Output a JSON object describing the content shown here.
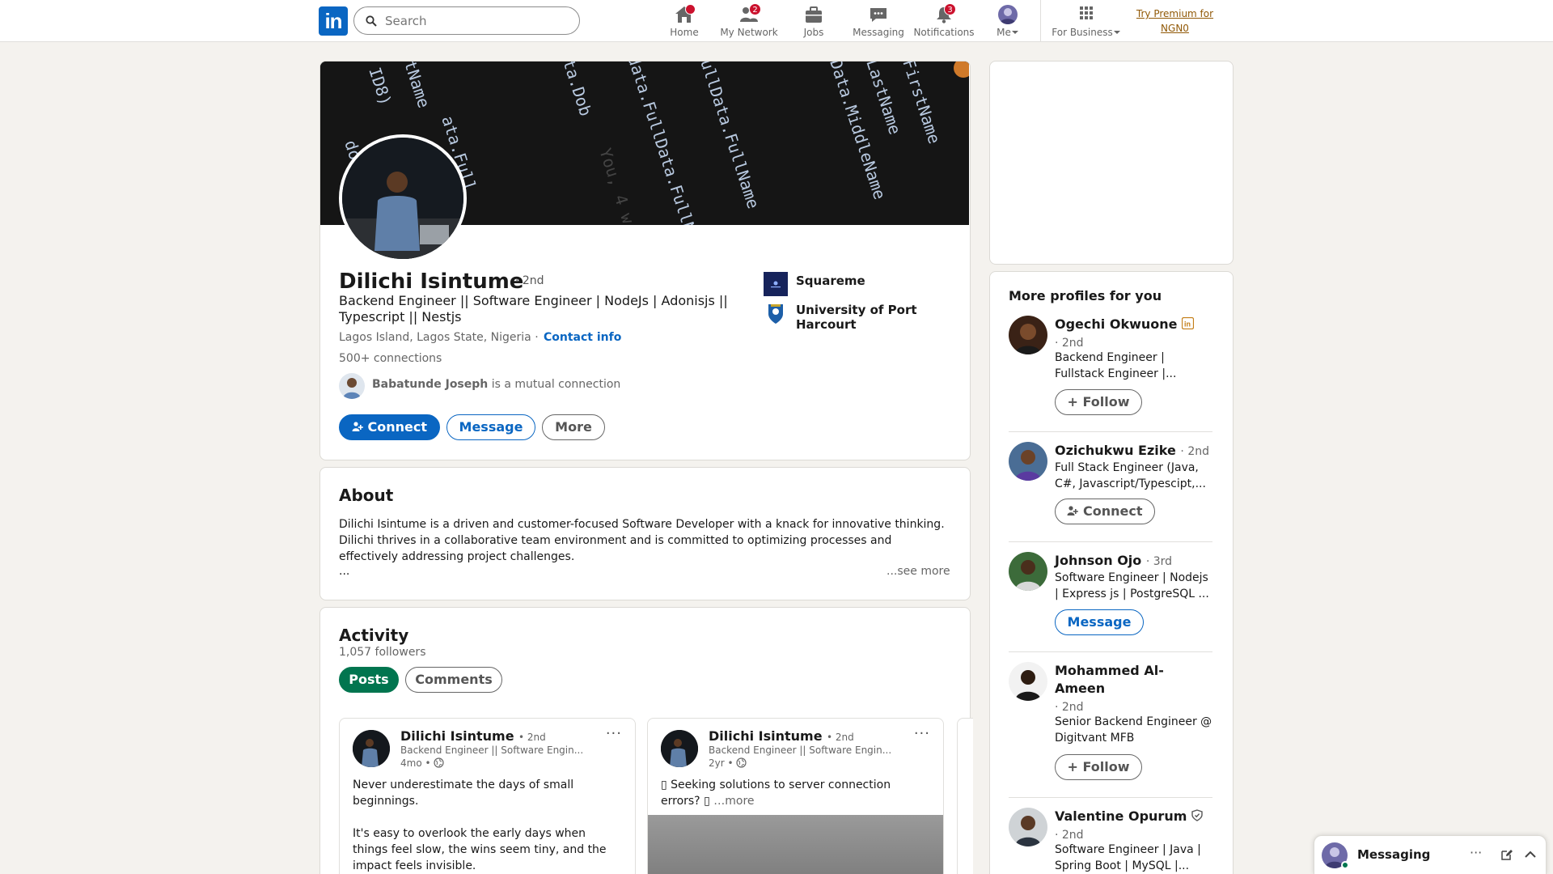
{
  "nav": {
    "search_placeholder": "Search",
    "items": [
      {
        "label": "Home",
        "icon": "home-icon",
        "badge": ""
      },
      {
        "label": "My Network",
        "icon": "people-icon",
        "badge": "2"
      },
      {
        "label": "Jobs",
        "icon": "briefcase-icon",
        "badge": ""
      },
      {
        "label": "Messaging",
        "icon": "chat-icon",
        "badge": ""
      },
      {
        "label": "Notifications",
        "icon": "bell-icon",
        "badge": "3"
      },
      {
        "label": "Me",
        "icon": "avatar"
      }
    ],
    "for_business": "For Business",
    "premium": "Try Premium for NGN0"
  },
  "profile": {
    "name": "Dilichi Isintume",
    "degree": "· 2nd",
    "headline": "Backend Engineer || Software Engineer | NodeJs | Adonisjs || Typescript || Nestjs",
    "location": "Lagos Island, Lagos State, Nigeria ·",
    "contact_info": "Contact info",
    "connections": "500+ connections",
    "mutual_name": "Babatunde Joseph",
    "mutual_suffix": "is a mutual connection",
    "connect": "Connect",
    "message": "Message",
    "more": "More",
    "company": "Squareme",
    "school": "University of Port Harcourt",
    "cover_code": [
      "dob = da",
      "stName",
      "ata.Full",
      "data.FullData.FullName",
      "ullData.FullName",
      "Data.MiddleName",
      "FirstName",
      "LastName",
      "ta.Dob",
      "ID8)",
      "You, 4 w"
    ]
  },
  "about": {
    "title": "About",
    "text": "Dilichi Isintume is a driven and customer-focused Software Developer with a knack for innovative thinking. Dilichi thrives in a collaborative team environment and is committed to optimizing processes and effectively addressing project challenges.",
    "ellipsis": "...",
    "see_more": "...see more"
  },
  "activity": {
    "title": "Activity",
    "followers": "1,057 followers",
    "tab_posts": "Posts",
    "tab_comments": "Comments",
    "posts": [
      {
        "author": "Dilichi Isintume",
        "degree": "• 2nd",
        "subtitle": "Backend Engineer || Software Engin...",
        "time": "4mo •",
        "text_1": "Never underestimate the days of small beginnings.",
        "text_2": "It's easy to overlook the early days when things feel slow, the wins seem tiny, and the impact feels invisible."
      },
      {
        "author": "Dilichi Isintume",
        "degree": "• 2nd",
        "subtitle": "Backend Engineer || Software Engin...",
        "time": "2yr •",
        "text_1": "▯ Seeking solutions to server connection errors? ▯",
        "more": "…more"
      }
    ]
  },
  "sidebar": {
    "title": "More profiles for you",
    "profiles": [
      {
        "name": "Ogechi Okwuone",
        "degree": "· 2nd",
        "headline": "Backend Engineer | Fullstack Engineer |...",
        "action": "+ Follow"
      },
      {
        "name": "Ozichukwu Ezike",
        "degree": "· 2nd",
        "headline": "Full Stack Engineer (Java, C#, Javascript/Typescipt,...",
        "action": "Connect"
      },
      {
        "name": "Johnson Ojo",
        "degree": "· 3rd",
        "headline": "Software Engineer | Nodejs | Express js | PostgreSQL ...",
        "action": "Message"
      },
      {
        "name": "Mohammed Al-Ameen",
        "degree": "· 2nd",
        "headline": "Senior Backend Engineer @ Digitvant MFB",
        "action": "+ Follow"
      },
      {
        "name": "Valentine Opurum",
        "degree": "· 2nd",
        "headline": "Software Engineer | Java | Spring Boot | MySQL |..."
      }
    ]
  },
  "messaging": {
    "label": "Messaging"
  },
  "colors": {
    "brand": "#0a66c2",
    "green": "#01754f",
    "badge": "#cb112d",
    "premium": "#915907"
  }
}
